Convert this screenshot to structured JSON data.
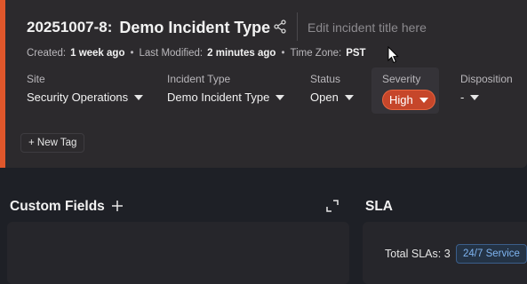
{
  "header": {
    "incident_id": "20251007-8:",
    "incident_title": "Demo Incident Type",
    "title_placeholder": "Edit incident title here",
    "meta": {
      "created_label": "Created:",
      "created_value": "1 week ago",
      "modified_label": "Last Modified:",
      "modified_value": "2 minutes ago",
      "timezone_label": "Time Zone:",
      "timezone_value": "PST",
      "separator": "•"
    },
    "fields": {
      "site": {
        "label": "Site",
        "value": "Security Operations"
      },
      "incident_type": {
        "label": "Incident Type",
        "value": "Demo Incident Type"
      },
      "status": {
        "label": "Status",
        "value": "Open"
      },
      "severity": {
        "label": "Severity",
        "value": "High"
      },
      "disposition": {
        "label": "Disposition",
        "value": "-"
      }
    },
    "new_tag_label": "+ New Tag"
  },
  "sections": {
    "custom_fields_title": "Custom Fields",
    "sla_title": "SLA",
    "sla_total": "Total SLAs: 3",
    "sla_badge": "24/7 Service"
  },
  "colors": {
    "accent": "#e0572b",
    "severity_high": "#c6462a",
    "sla_badge_text": "#7fb4f0"
  },
  "icons": [
    "share-icon",
    "cursor-icon",
    "chevron-down-icon",
    "plus-icon",
    "expand-icon"
  ]
}
